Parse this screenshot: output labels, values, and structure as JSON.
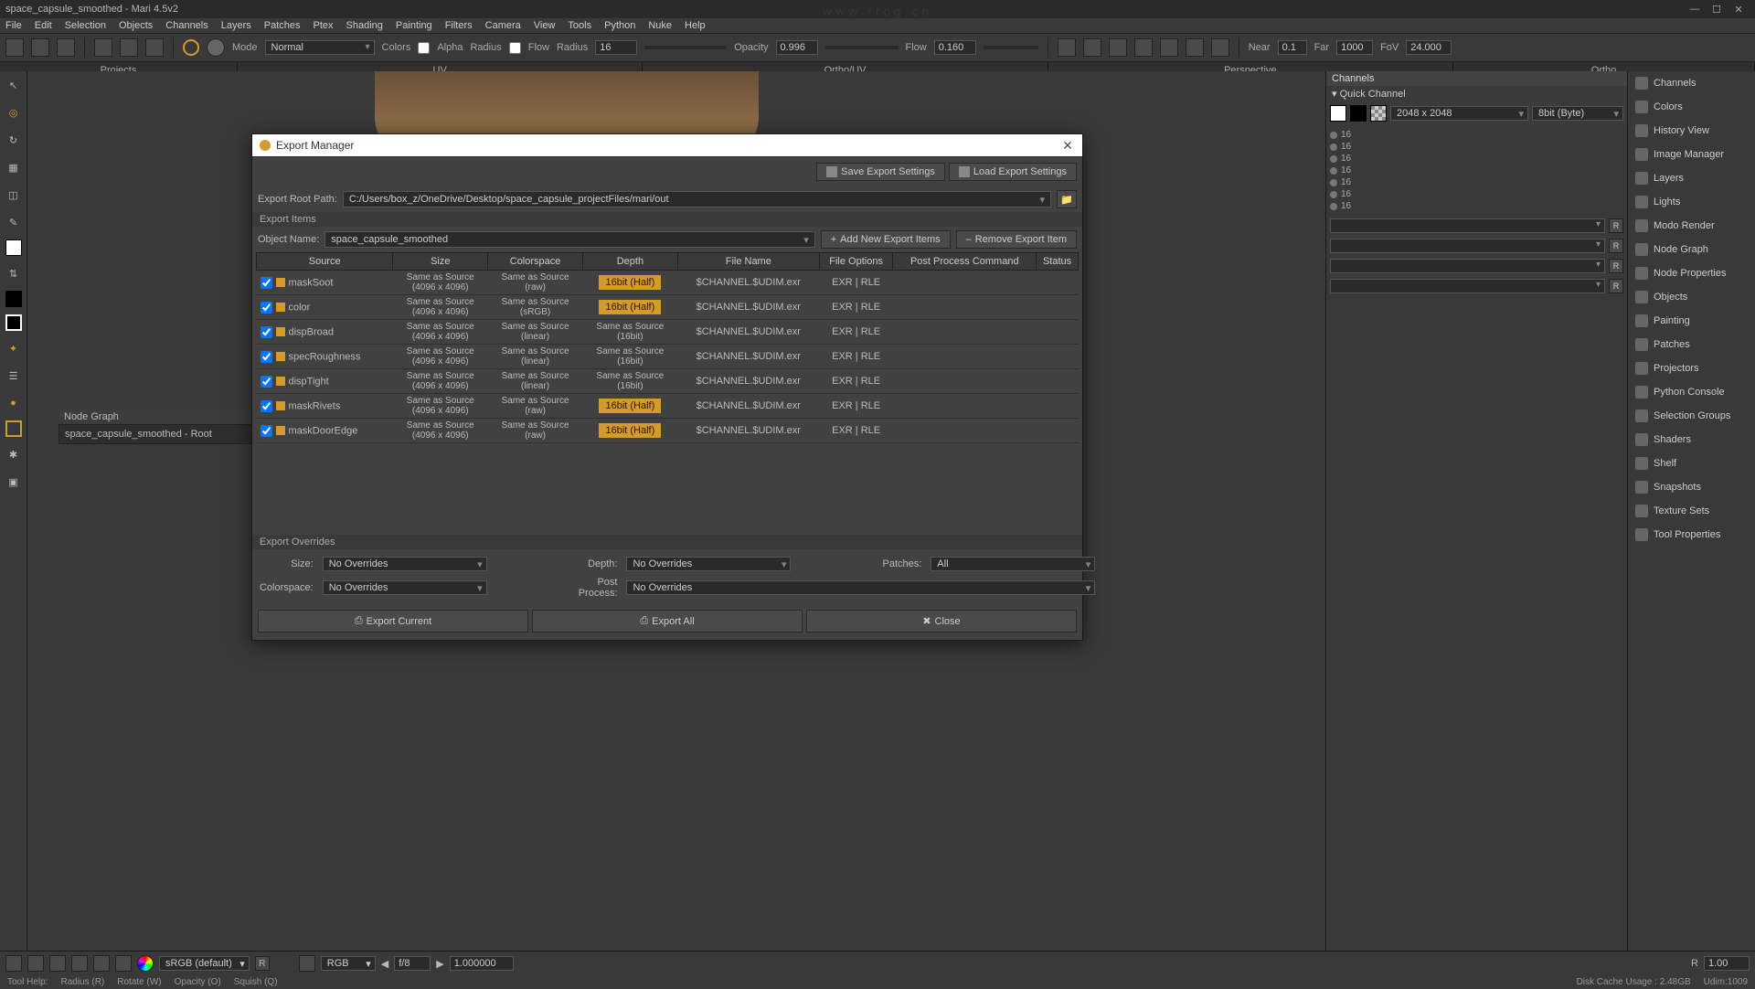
{
  "window": {
    "title": "space_capsule_smoothed - Mari 4.5v2"
  },
  "url_wm": "www.rrcg.cn",
  "menu": [
    "File",
    "Edit",
    "Selection",
    "Objects",
    "Channels",
    "Layers",
    "Patches",
    "Ptex",
    "Shading",
    "Painting",
    "Filters",
    "Camera",
    "View",
    "Tools",
    "Python",
    "Nuke",
    "Help"
  ],
  "toolbar": {
    "mode_label": "Mode",
    "mode_value": "Normal",
    "colors": "Colors",
    "alpha": "Alpha",
    "radius_label": "Radius",
    "flow": "Flow",
    "radius_val": "16",
    "opacity_label": "Opacity",
    "opacity_val": "0.996",
    "flow_label": "Flow",
    "flow_val": "0.160",
    "near_label": "Near",
    "near_val": "0.1",
    "far_label": "Far",
    "far_val": "1000",
    "fov_label": "FoV",
    "fov_val": "24.000"
  },
  "view_tabs": [
    "Projects",
    "UV",
    "Ortho/UV",
    "Perspective",
    "Ortho"
  ],
  "node_graph": {
    "title": "Node Graph",
    "root": "space_capsule_smoothed - Root"
  },
  "channels_panel": {
    "title": "Channels",
    "quick": "Quick Channel",
    "size": "2048 x 2048",
    "depth": "8bit  (Byte)",
    "rows": [
      "16",
      "16",
      "16",
      "16",
      "16",
      "16",
      "16"
    ]
  },
  "far_right": [
    "Channels",
    "Colors",
    "History View",
    "Image Manager",
    "Layers",
    "Lights",
    "Modo Render",
    "Node Graph",
    "Node Properties",
    "Objects",
    "Painting",
    "Patches",
    "Projectors",
    "Python Console",
    "Selection Groups",
    "Shaders",
    "Shelf",
    "Snapshots",
    "Texture Sets",
    "Tool Properties"
  ],
  "export": {
    "title": "Export Manager",
    "save_btn": "Save Export Settings",
    "load_btn": "Load Export Settings",
    "root_label": "Export Root Path:",
    "root_val": "C:/Users/box_z/OneDrive/Desktop/space_capsule_projectFiles/mari/out",
    "items_label": "Export Items",
    "obj_label": "Object Name:",
    "obj_val": "space_capsule_smoothed",
    "add_btn": "Add New Export Items",
    "remove_btn": "Remove Export Item",
    "cols": [
      "Source",
      "Size",
      "Colorspace",
      "Depth",
      "File Name",
      "File Options",
      "Post Process Command",
      "Status"
    ],
    "rows": [
      {
        "name": "maskSoot",
        "size1": "Same as Source",
        "size2": "(4096 x 4096)",
        "cs1": "Same as Source",
        "cs2": "(raw)",
        "depth": "16bit (Half)",
        "dhl": true,
        "fn": "$CHANNEL.$UDIM.exr",
        "opt": "EXR | RLE"
      },
      {
        "name": "color",
        "size1": "Same as Source",
        "size2": "(4096 x 4096)",
        "cs1": "Same as Source",
        "cs2": "(sRGB)",
        "depth": "16bit (Half)",
        "dhl": true,
        "fn": "$CHANNEL.$UDIM.exr",
        "opt": "EXR | RLE"
      },
      {
        "name": "dispBroad",
        "size1": "Same as Source",
        "size2": "(4096 x 4096)",
        "cs1": "Same as Source",
        "cs2": "(linear)",
        "depth1": "Same as Source",
        "depth2": "(16bit)",
        "dhl": false,
        "fn": "$CHANNEL.$UDIM.exr",
        "opt": "EXR | RLE"
      },
      {
        "name": "specRoughness",
        "size1": "Same as Source",
        "size2": "(4096 x 4096)",
        "cs1": "Same as Source",
        "cs2": "(linear)",
        "depth1": "Same as Source",
        "depth2": "(16bit)",
        "dhl": false,
        "fn": "$CHANNEL.$UDIM.exr",
        "opt": "EXR | RLE"
      },
      {
        "name": "dispTight",
        "size1": "Same as Source",
        "size2": "(4096 x 4096)",
        "cs1": "Same as Source",
        "cs2": "(linear)",
        "depth1": "Same as Source",
        "depth2": "(16bit)",
        "dhl": false,
        "fn": "$CHANNEL.$UDIM.exr",
        "opt": "EXR | RLE"
      },
      {
        "name": "maskRivets",
        "size1": "Same as Source",
        "size2": "(4096 x 4096)",
        "cs1": "Same as Source",
        "cs2": "(raw)",
        "depth": "16bit (Half)",
        "dhl": true,
        "fn": "$CHANNEL.$UDIM.exr",
        "opt": "EXR | RLE"
      },
      {
        "name": "maskDoorEdge",
        "size1": "Same as Source",
        "size2": "(4096 x 4096)",
        "cs1": "Same as Source",
        "cs2": "(raw)",
        "depth": "16bit (Half)",
        "dhl": true,
        "fn": "$CHANNEL.$UDIM.exr",
        "opt": "EXR | RLE"
      }
    ],
    "ov_title": "Export Overrides",
    "ov_size_l": "Size:",
    "ov_size_v": "No Overrides",
    "ov_cs_l": "Colorspace:",
    "ov_cs_v": "No Overrides",
    "ov_depth_l": "Depth:",
    "ov_depth_v": "No Overrides",
    "ov_pp_l": "Post Process:",
    "ov_pp_v": "No Overrides",
    "ov_patches_l": "Patches:",
    "ov_patches_v": "All",
    "export_current": "Export Current",
    "export_all": "Export All",
    "close": "Close"
  },
  "status": {
    "cs": "sRGB (default)",
    "reset": "R",
    "rgb": "RGB",
    "fstop": "f/8",
    "exposure": "1.000000",
    "r": "R",
    "rv": "1.00",
    "hints": [
      "Tool Help:",
      "Radius (R)",
      "Rotate (W)",
      "Opacity (O)",
      "Squish (Q)"
    ],
    "disk": "Disk Cache Usage : 2.48GB",
    "udim": "Udim:1009"
  }
}
